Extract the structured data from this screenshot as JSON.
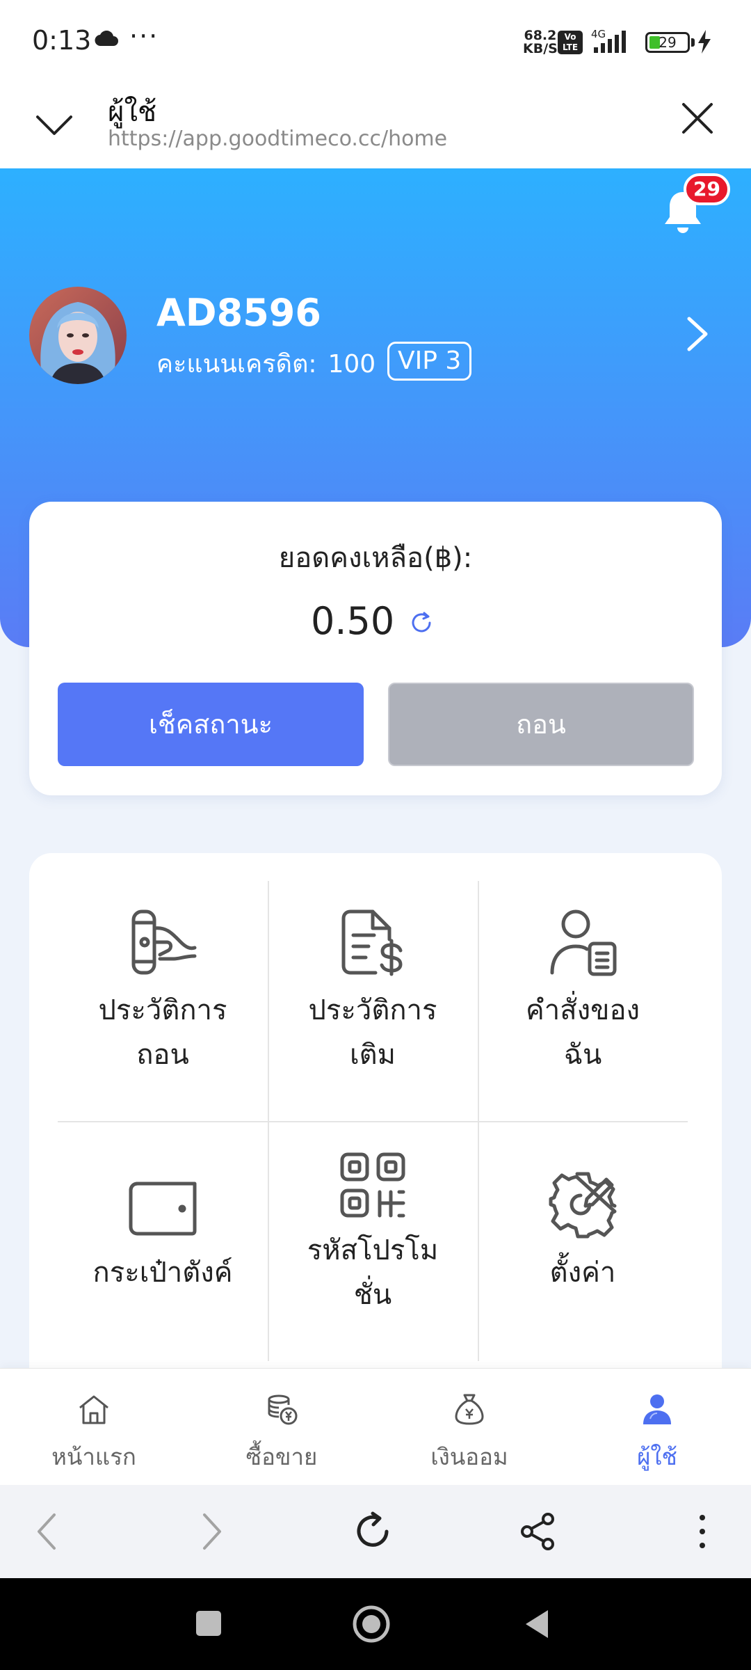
{
  "status_bar": {
    "time": "0:13",
    "speed_value": "68.2",
    "speed_unit": "KB/S",
    "volte": "Vo LTE",
    "network": "4G",
    "battery": "29",
    "battery_fraction": 0.29
  },
  "browser": {
    "title": "ผู้ใช้",
    "url": "https://app.goodtimeco.cc/home"
  },
  "profile": {
    "notification_count": "29",
    "username": "AD8596",
    "credit_label": "คะแนนเครดิต:",
    "credit_value": "100",
    "vip_badge": "VIP 3"
  },
  "balance": {
    "label": "ยอดคงเหลือ(฿):",
    "amount": "0.50",
    "check_status_button": "เช็คสถานะ",
    "withdraw_button": "ถอน"
  },
  "menu": {
    "items": [
      {
        "line1": "ประวัติการ",
        "line2": "ถอน",
        "icon": "withdraw-history-icon"
      },
      {
        "line1": "ประวัติการ",
        "line2": "เติม",
        "icon": "deposit-history-icon"
      },
      {
        "line1": "คำสั่งของ",
        "line2": "ฉัน",
        "icon": "my-orders-icon"
      },
      {
        "line1": "กระเป๋าตังค์",
        "line2": "",
        "icon": "wallet-icon"
      },
      {
        "line1": "รหัสโปรโม",
        "line2": "ชั่น",
        "icon": "qr-code-icon"
      },
      {
        "line1": "ตั้งค่า",
        "line2": "",
        "icon": "settings-gear-icon"
      }
    ]
  },
  "bottom_nav": {
    "items": [
      {
        "label": "หน้าแรก",
        "icon": "home-icon"
      },
      {
        "label": "ซื้อขาย",
        "icon": "coins-icon"
      },
      {
        "label": "เงินออม",
        "icon": "money-bag-icon"
      },
      {
        "label": "ผู้ใช้",
        "icon": "user-icon"
      }
    ],
    "active_index": 3,
    "active_color": "#4d6ff0"
  },
  "colors": {
    "hero_top": "#2db0ff",
    "hero_bottom": "#5a7cf5",
    "primary_button": "#5577f6",
    "disabled_button": "#aeb1ba",
    "badge": "#e8192c"
  }
}
